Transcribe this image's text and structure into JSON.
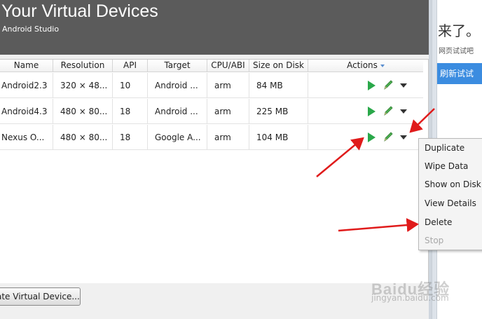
{
  "background_page": {
    "big_text": "来了。",
    "small_text": "网页试试吧",
    "button_label": "刷新试试"
  },
  "window": {
    "title": "Your Virtual Devices",
    "subtitle": "Android Studio"
  },
  "table": {
    "headers": {
      "name": "Name",
      "resolution": "Resolution",
      "api": "API",
      "target": "Target",
      "cpu": "CPU/ABI",
      "size": "Size on Disk",
      "actions": "Actions"
    },
    "rows": [
      {
        "name": "Android2.3",
        "resolution": "320 × 48...",
        "api": "10",
        "target": "Android ...",
        "cpu": "arm",
        "size": "84 MB"
      },
      {
        "name": "Android4.3",
        "resolution": "480 × 80...",
        "api": "18",
        "target": "Android ...",
        "cpu": "arm",
        "size": "225 MB"
      },
      {
        "name": "Nexus O...",
        "resolution": "480 × 80...",
        "api": "18",
        "target": "Google A...",
        "cpu": "arm",
        "size": "104 MB"
      }
    ]
  },
  "create_button_label": "ate Virtual Device...",
  "context_menu": {
    "items": [
      {
        "label": "Duplicate",
        "enabled": true
      },
      {
        "label": "Wipe Data",
        "enabled": true
      },
      {
        "label": "Show on Disk",
        "enabled": true
      },
      {
        "label": "View Details",
        "enabled": true
      },
      {
        "label": "Delete",
        "enabled": true
      },
      {
        "label": "Stop",
        "enabled": false
      }
    ]
  },
  "watermark": {
    "logo": "Baidu经验",
    "url": "jingyan.baidu.com"
  },
  "colors": {
    "header_bg": "#5b5b5b",
    "play_green": "#2aa84a",
    "edit_green": "#4caf50",
    "annotation_red": "#e01b1b",
    "sort_arrow_blue": "#5b8fd0"
  },
  "icons": {
    "play": "play-icon",
    "edit": "pencil-icon",
    "menu": "dropdown-arrow-icon",
    "sort": "sort-descending-icon"
  }
}
